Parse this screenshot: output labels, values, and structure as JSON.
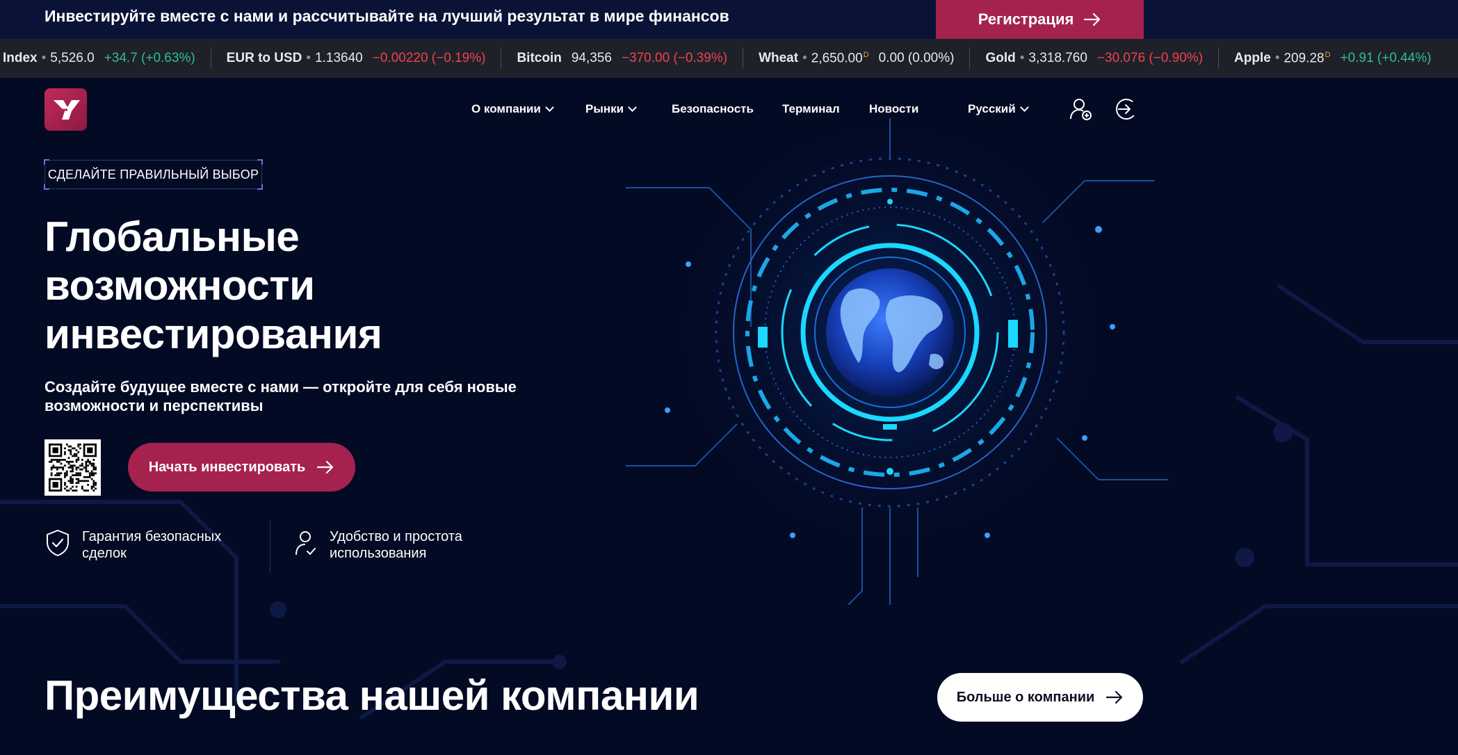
{
  "promo": {
    "text": "Инвестируйте вместе с нами и рассчитывайте на лучший результат в мире финансов",
    "register_label": "Регистрация"
  },
  "ticker": [
    {
      "name": "Index",
      "price": "5,526.0",
      "change": "+34.7 (+0.63%)",
      "direction": "up",
      "delayed": false,
      "dot": true
    },
    {
      "name": "EUR to USD",
      "price": "1.13640",
      "change": "−0.00220 (−0.19%)",
      "direction": "down",
      "delayed": false,
      "dot": true
    },
    {
      "name": "Bitcoin",
      "price": "94,356",
      "change": "−370.00 (−0.39%)",
      "direction": "down",
      "delayed": false,
      "dot": false
    },
    {
      "name": "Wheat",
      "price": "2,650.00",
      "change": "0.00 (0.00%)",
      "direction": "flat",
      "delayed": true,
      "dot": true
    },
    {
      "name": "Gold",
      "price": "3,318.760",
      "change": "−30.076 (−0.90%)",
      "direction": "down",
      "delayed": false,
      "dot": true
    },
    {
      "name": "Apple",
      "price": "209.28",
      "change": "+0.91 (+0.44%)",
      "direction": "up",
      "delayed": true,
      "dot": true
    }
  ],
  "ticker_delayed_mark": "D",
  "nav": {
    "about": "О компании",
    "markets": "Рынки",
    "security": "Безопасность",
    "terminal": "Терминал",
    "news": "Новости",
    "language": "Русский"
  },
  "hero": {
    "tag": "СДЕЛАЙТЕ ПРАВИЛЬНЫЙ ВЫБОР",
    "title_line1": "Глобальные",
    "title_line2": "возможности",
    "title_line3": "инвестирования",
    "subtitle": "Создайте будущее вместе с нами — откройте для себя новые возможности и перспективы",
    "cta_label": "Начать инвестировать"
  },
  "features": [
    {
      "text": "Гарантия безопасных сделок",
      "icon": "shield-check-icon"
    },
    {
      "text": "Удобство и простота использования",
      "icon": "user-check-icon"
    }
  ],
  "section": {
    "title": "Преимущества нашей компании",
    "more_label": "Больше о компании"
  },
  "colors": {
    "background": "#030a24",
    "accent": "#a5224f",
    "up": "#2fbf8a",
    "down": "#f0424f",
    "glow": "#1ad8ff"
  }
}
